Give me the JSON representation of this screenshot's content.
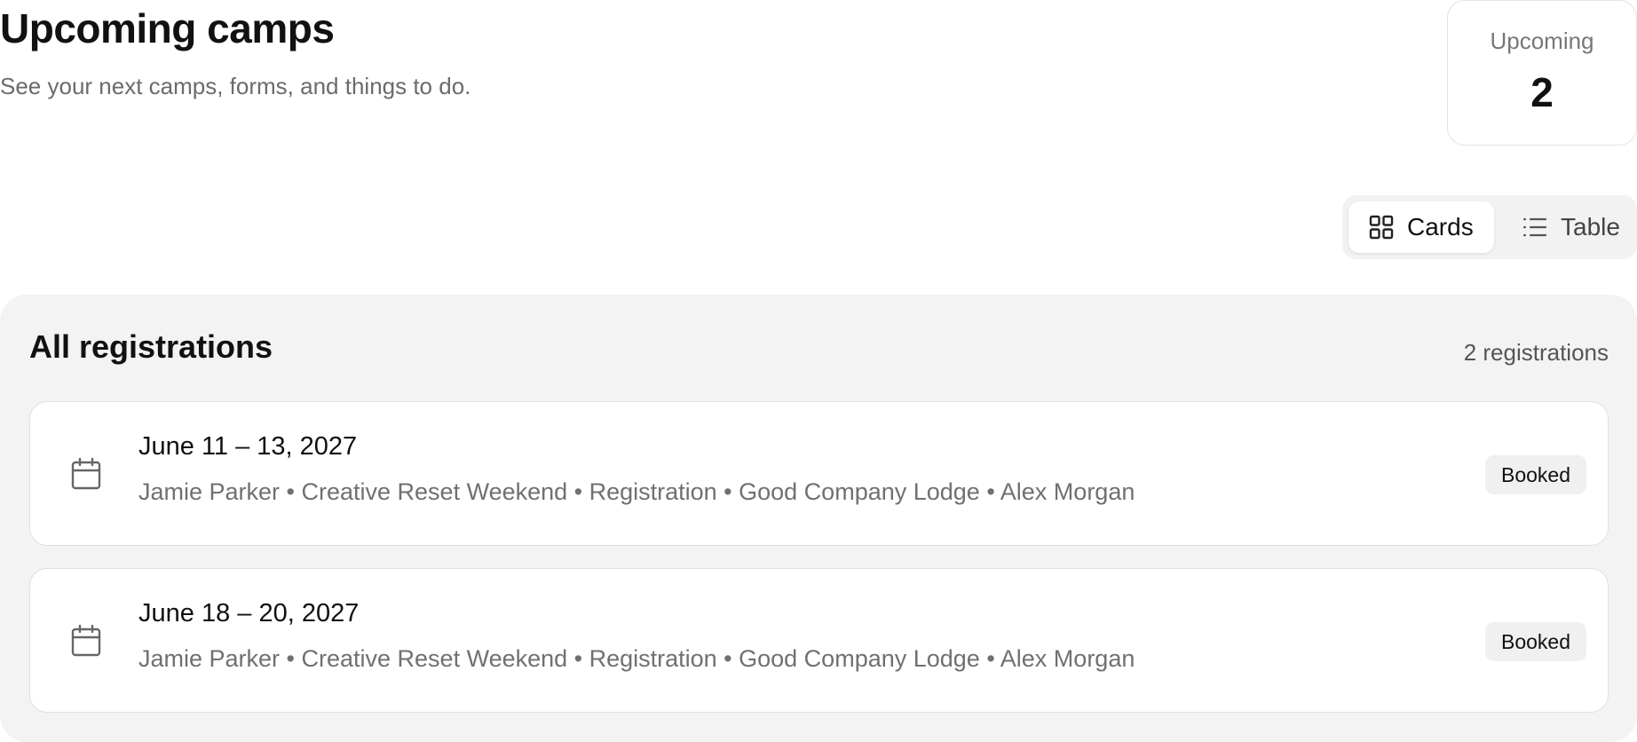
{
  "header": {
    "title": "Upcoming camps",
    "subtitle": "See your next camps, forms, and things to do."
  },
  "stats": {
    "upcoming_label": "Upcoming",
    "upcoming_value": "2"
  },
  "view_toggle": {
    "cards_label": "Cards",
    "table_label": "Table",
    "active": "cards",
    "cards_icon": "grid-icon",
    "table_icon": "list-icon"
  },
  "registrations": {
    "title": "All registrations",
    "count_label": "2 registrations",
    "items": [
      {
        "date": "June 11 – 13, 2027",
        "meta": "Jamie Parker • Creative Reset Weekend • Registration • Good Company Lodge • Alex Morgan",
        "status": "Booked",
        "icon": "calendar-icon"
      },
      {
        "date": "June 18 – 20, 2027",
        "meta": "Jamie Parker • Creative Reset Weekend • Registration • Good Company Lodge • Alex Morgan",
        "status": "Booked",
        "icon": "calendar-icon"
      }
    ]
  }
}
